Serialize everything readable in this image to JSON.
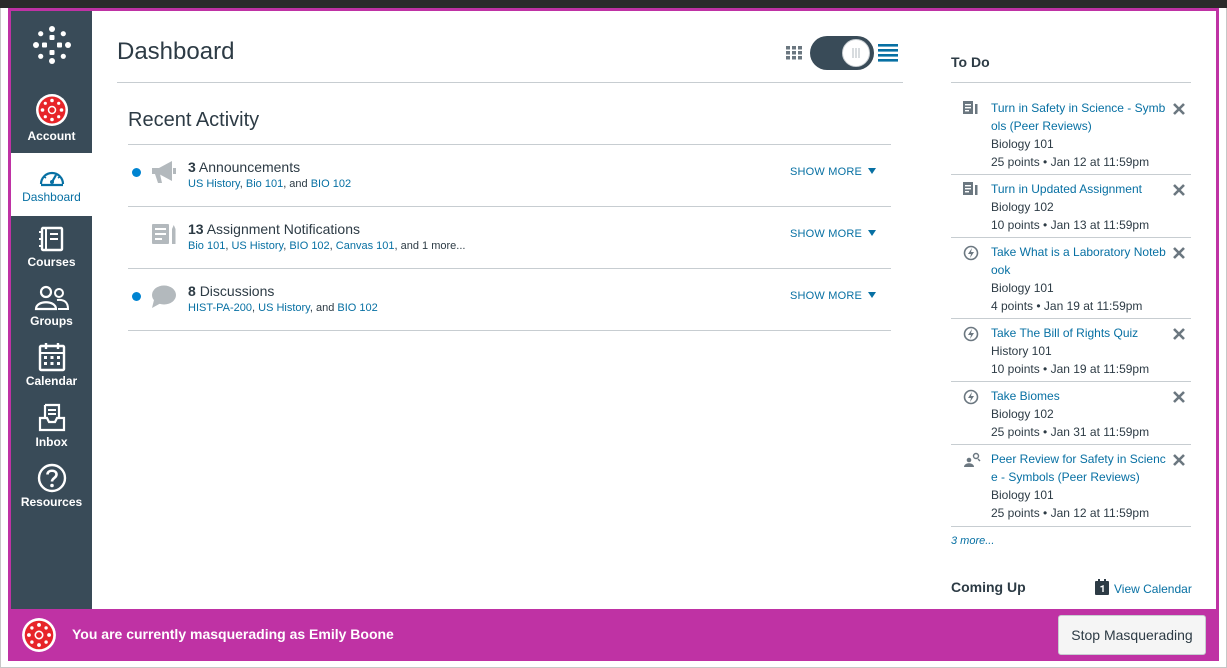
{
  "nav": {
    "account": "Account",
    "dashboard": "Dashboard",
    "courses": "Courses",
    "groups": "Groups",
    "calendar": "Calendar",
    "inbox": "Inbox",
    "resources": "Resources"
  },
  "header": {
    "title": "Dashboard"
  },
  "recent_activity": {
    "title": "Recent Activity",
    "show_more": "SHOW MORE",
    "rows": [
      {
        "count": "3",
        "label": "Announcements",
        "unread": true,
        "icon": "megaphone-icon",
        "links": [
          "US History",
          "Bio 101",
          "BIO 102"
        ],
        "sep1": ", ",
        "sep2": ", and ",
        "suffix": ""
      },
      {
        "count": "13",
        "label": "Assignment Notifications",
        "unread": false,
        "icon": "assignment-icon",
        "links": [
          "Bio 101",
          "US History",
          "BIO 102",
          "Canvas 101"
        ],
        "sep1": ", ",
        "suffix": ", and 1 more..."
      },
      {
        "count": "8",
        "label": "Discussions",
        "unread": true,
        "icon": "discussion-icon",
        "links": [
          "HIST-PA-200",
          "US History",
          "BIO 102"
        ],
        "sep1": ", ",
        "sep2": ", and ",
        "suffix": ""
      }
    ]
  },
  "todo": {
    "title": "To Do",
    "items": [
      {
        "icon": "assignment-icon",
        "title": "Turn in Safety in Science - Symbols (Peer Reviews)",
        "course": "Biology 101",
        "due": "25 points • Jan 12 at 11:59pm"
      },
      {
        "icon": "assignment-icon",
        "title": "Turn in Updated Assignment",
        "course": "Biology 102",
        "due": "10 points • Jan 13 at 11:59pm"
      },
      {
        "icon": "quiz-icon",
        "title": "Take What is a Laboratory Notebook",
        "course": "Biology 101",
        "due": "4 points • Jan 19 at 11:59pm"
      },
      {
        "icon": "quiz-icon",
        "title": "Take The Bill of Rights Quiz",
        "course": "History 101",
        "due": "10 points • Jan 19 at 11:59pm"
      },
      {
        "icon": "quiz-icon",
        "title": "Take Biomes",
        "course": "Biology 102",
        "due": "25 points • Jan 31 at 11:59pm"
      },
      {
        "icon": "peer-review-icon",
        "title": "Peer Review for Safety in Science - Symbols (Peer Reviews)",
        "course": "Biology 101",
        "due": "25 points • Jan 12 at 11:59pm"
      }
    ],
    "more": "3 more..."
  },
  "coming_up": {
    "title": "Coming Up",
    "view_calendar": "View Calendar"
  },
  "masquerade": {
    "message": "You are currently masquerading as Emily Boone",
    "stop_button": "Stop Masquerading"
  },
  "colors": {
    "sidebar": "#394b58",
    "link": "#0770a3",
    "masquerade": "#bf32a4",
    "unread_dot": "#0084d1"
  }
}
